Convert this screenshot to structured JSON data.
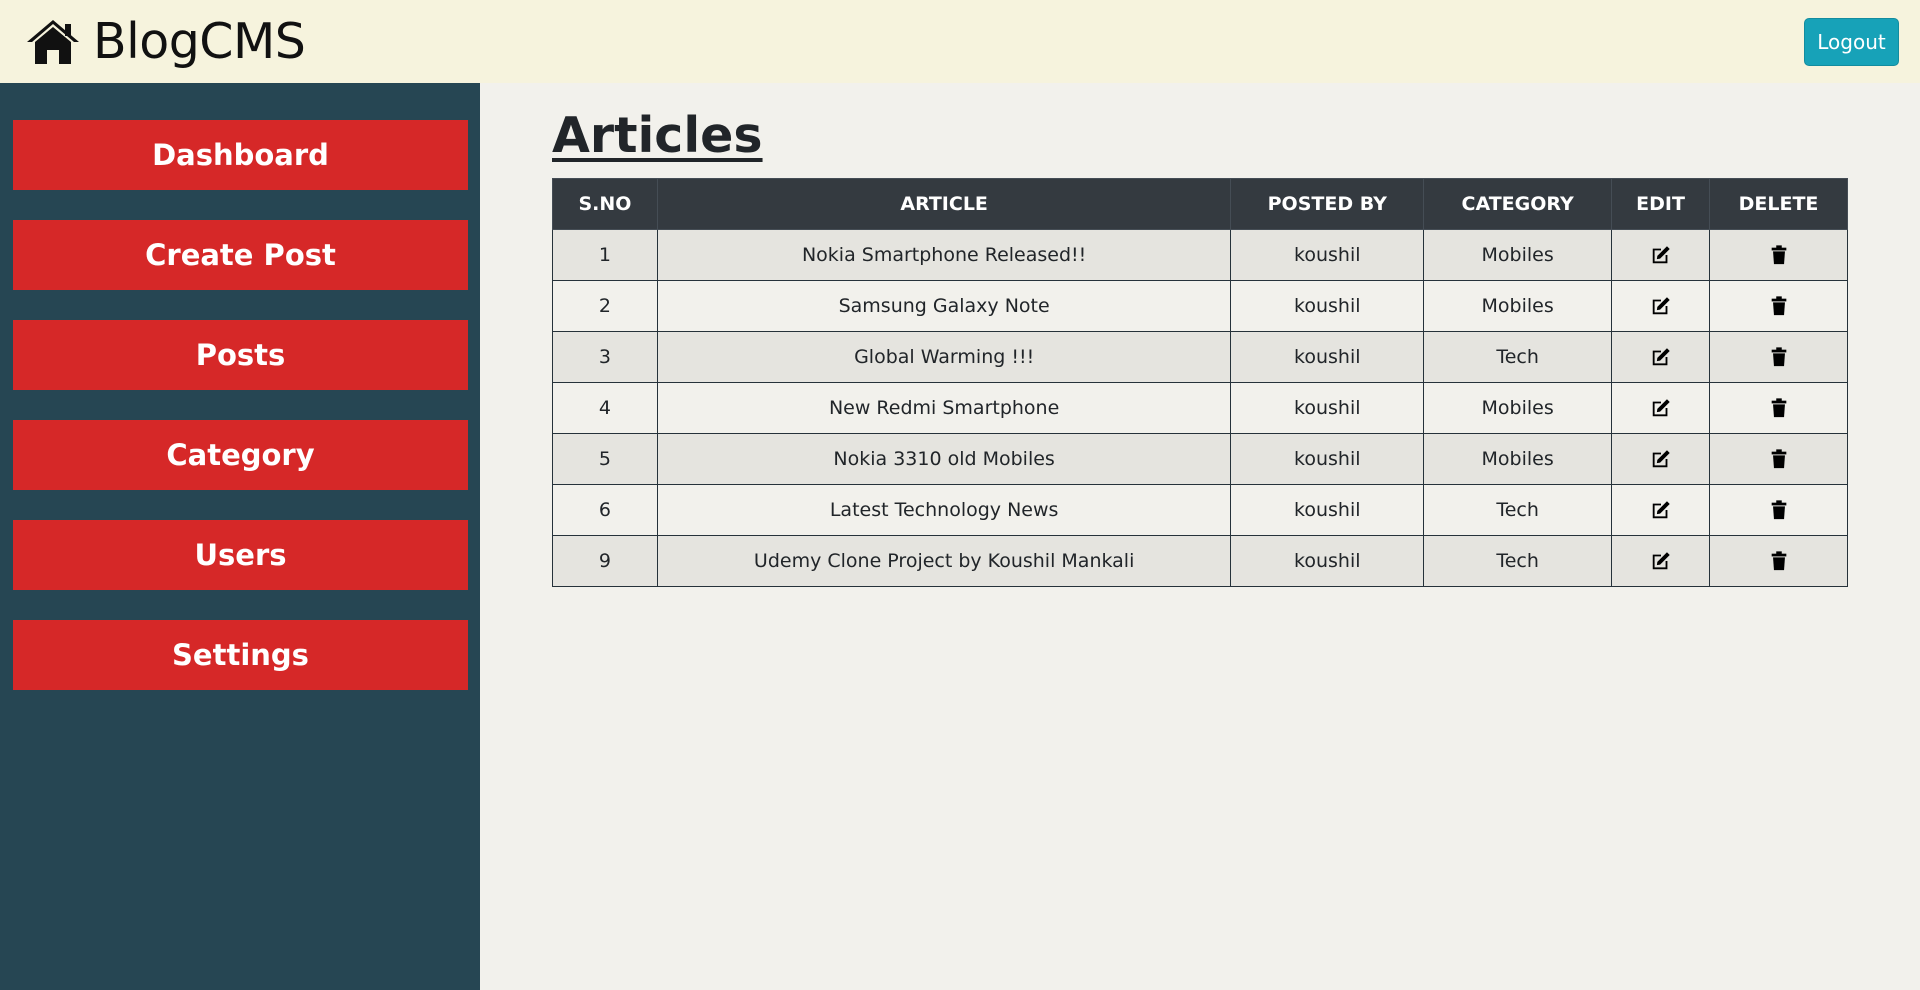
{
  "header": {
    "brand": "BlogCMS",
    "brand_icon": "home-icon",
    "logout_label": "Logout"
  },
  "sidebar": {
    "items": [
      {
        "label": "Dashboard"
      },
      {
        "label": "Create Post"
      },
      {
        "label": "Posts"
      },
      {
        "label": "Category"
      },
      {
        "label": "Users"
      },
      {
        "label": "Settings"
      }
    ]
  },
  "main": {
    "title": "Articles",
    "table": {
      "columns": [
        "S.NO",
        "ARTICLE",
        "POSTED BY",
        "CATEGORY",
        "EDIT",
        "DELETE"
      ],
      "rows": [
        {
          "sno": "1",
          "article": "Nokia Smartphone Released!!",
          "posted_by": "koushil",
          "category": "Mobiles"
        },
        {
          "sno": "2",
          "article": "Samsung Galaxy Note",
          "posted_by": "koushil",
          "category": "Mobiles"
        },
        {
          "sno": "3",
          "article": "Global Warming !!!",
          "posted_by": "koushil",
          "category": "Tech"
        },
        {
          "sno": "4",
          "article": "New Redmi Smartphone",
          "posted_by": "koushil",
          "category": "Mobiles"
        },
        {
          "sno": "5",
          "article": "Nokia 3310 old Mobiles",
          "posted_by": "koushil",
          "category": "Mobiles"
        },
        {
          "sno": "6",
          "article": "Latest Technology News",
          "posted_by": "koushil",
          "category": "Tech"
        },
        {
          "sno": "9",
          "article": "Udemy Clone Project by Koushil Mankali",
          "posted_by": "koushil",
          "category": "Tech"
        }
      ]
    }
  },
  "colors": {
    "header_bg": "#f6f3dd",
    "sidebar_bg": "#264653",
    "nav_button": "#d62828",
    "logout_button": "#17a2b8",
    "table_header": "#343a40"
  }
}
